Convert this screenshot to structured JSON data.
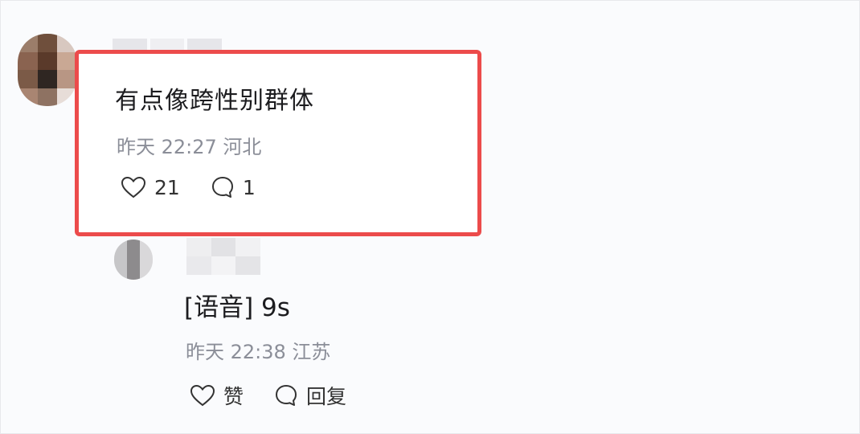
{
  "comment": {
    "text": "有点像跨性别群体",
    "meta": "昨天 22:27 河北",
    "like_count": "21",
    "reply_count": "1",
    "highlight_color": "#ec4b4b"
  },
  "reply": {
    "text": "[语音] 9s",
    "meta": "昨天 22:38 江苏",
    "like_label": "赞",
    "reply_label": "回复"
  },
  "icons": [
    "heart-icon",
    "comment-bubble-icon"
  ]
}
